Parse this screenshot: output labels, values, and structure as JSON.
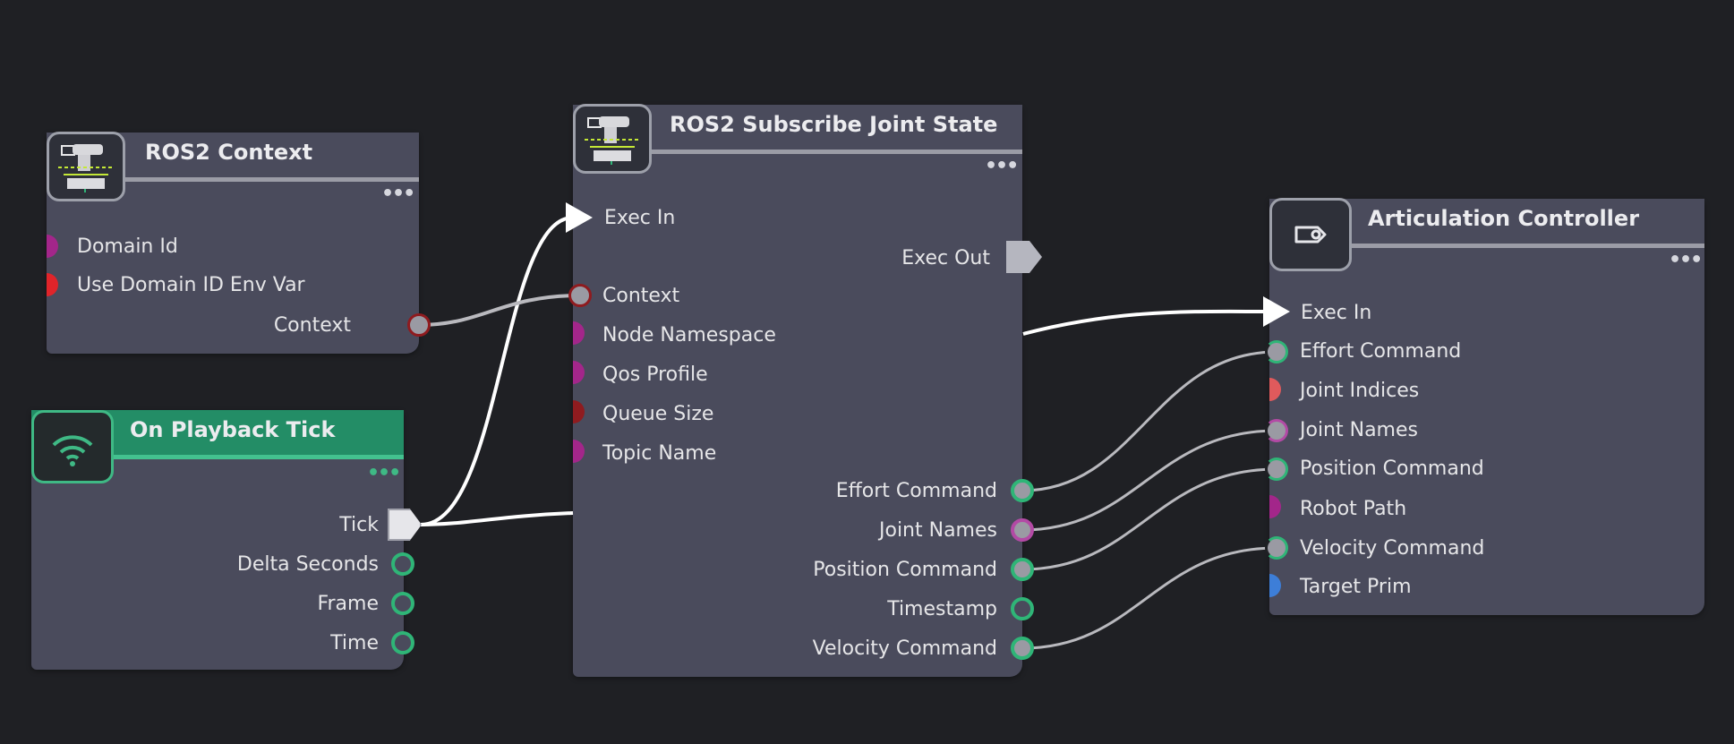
{
  "nodes": {
    "ros2_context": {
      "title": "ROS2 Context",
      "inputs": [
        "Domain Id",
        "Use Domain ID Env Var"
      ],
      "outputs": [
        "Context"
      ]
    },
    "on_playback_tick": {
      "title": "On Playback Tick",
      "outputs": [
        "Tick",
        "Delta Seconds",
        "Frame",
        "Time"
      ]
    },
    "subscribe_joint_state": {
      "title": "ROS2 Subscribe Joint State",
      "inputs": [
        "Exec In",
        "Context",
        "Node Namespace",
        "Qos Profile",
        "Queue Size",
        "Topic Name"
      ],
      "outputs": [
        "Exec Out",
        "Effort Command",
        "Joint Names",
        "Position Command",
        "Timestamp",
        "Velocity Command"
      ]
    },
    "articulation_controller": {
      "title": "Articulation Controller",
      "inputs": [
        "Exec In",
        "Effort Command",
        "Joint Indices",
        "Joint Names",
        "Position Command",
        "Robot Path",
        "Velocity Command",
        "Target Prim"
      ]
    }
  },
  "more_menu": "•••",
  "icons": {
    "ros2_context": "robot-arm-icon",
    "on_playback_tick": "wifi-icon",
    "subscribe_joint_state": "robot-arm-icon",
    "articulation_controller": "controller-icon"
  },
  "colors": {
    "background": "#1f2024",
    "node_body": "#4a4b5c",
    "header_green": "#238d66",
    "port_magenta": "#a3268a",
    "port_red": "#e0242a",
    "port_darkred": "#8f1b1f",
    "port_green": "#2fb577",
    "port_gray": "#9a9aa3",
    "port_salmon": "#e05a5c",
    "port_blue": "#3d7ed8",
    "wire_exec": "#ffffff",
    "wire_data": "#b9b9be"
  }
}
